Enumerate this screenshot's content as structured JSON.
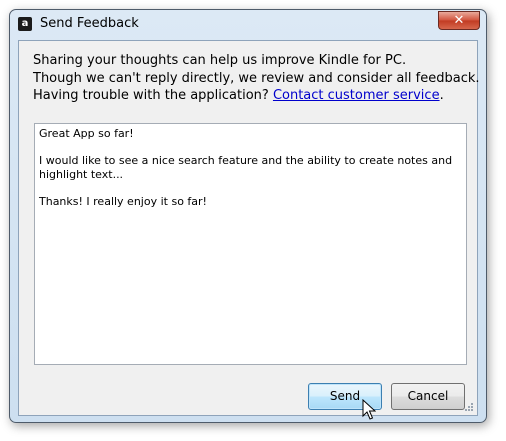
{
  "window": {
    "title": "Send Feedback",
    "app_icon": "amazon-icon",
    "app_icon_glyph": "a",
    "close_glyph": "✕"
  },
  "intro": {
    "line1": "Sharing your thoughts can help us improve Kindle for PC.",
    "line2": "Though we can't reply directly, we review and consider all feedback.",
    "line3_prefix": "Having trouble with the application? ",
    "line3_link": "Contact customer service",
    "line3_suffix": "."
  },
  "feedback": {
    "value": "Great App so far!\n\nI would like to see a nice search feature and the ability to create notes and highlight text...\n\nThanks! I really enjoy it so far!"
  },
  "buttons": {
    "send": "Send",
    "cancel": "Cancel"
  },
  "colors": {
    "link": "#0000cc",
    "close_button": "#c13b22",
    "default_button_border": "#3c7fb1"
  }
}
